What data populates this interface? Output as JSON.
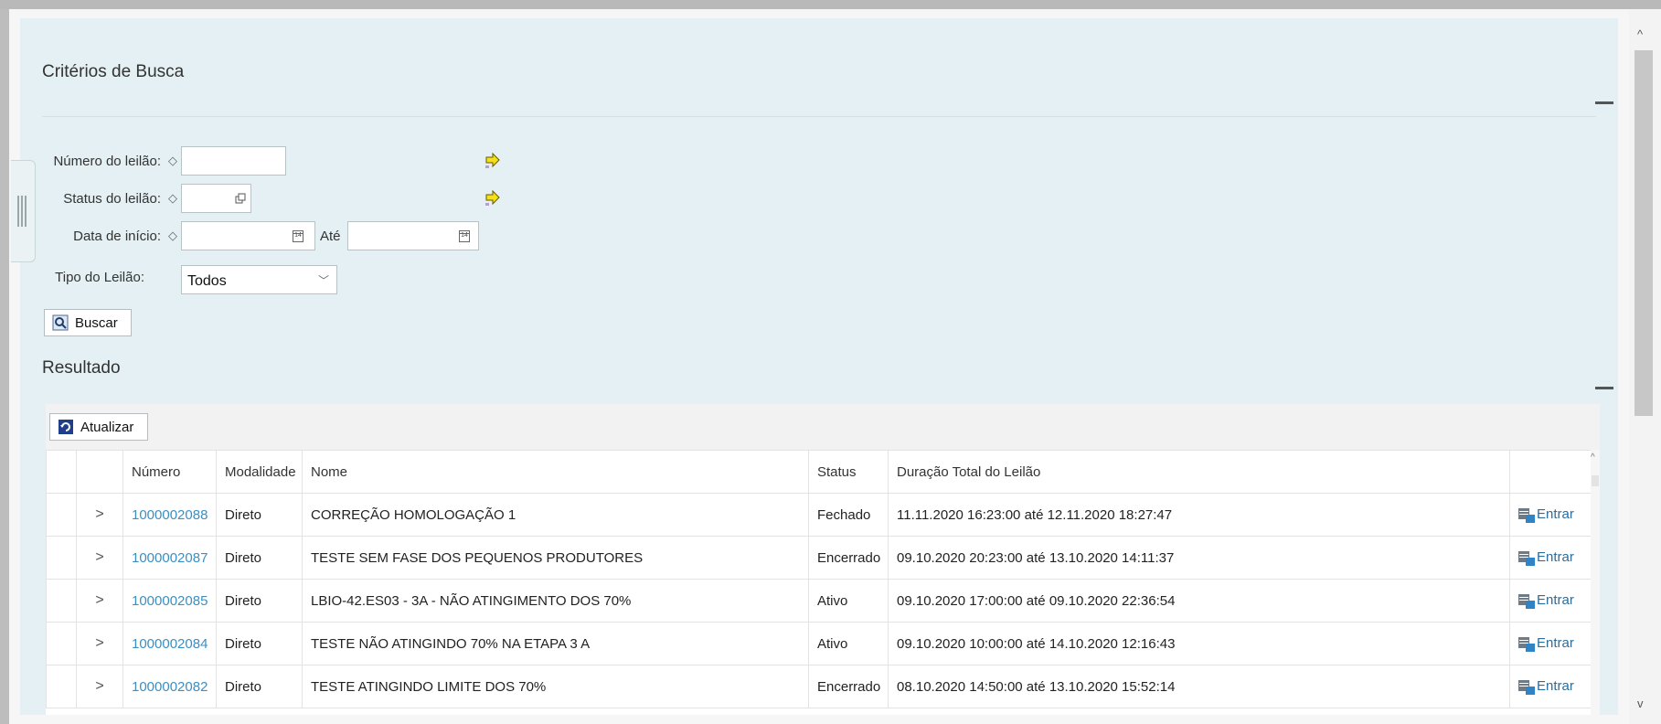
{
  "criteria": {
    "title": "Critérios de Busca",
    "fields": {
      "numero_label": "Número do leilão:",
      "status_label": "Status do leilão:",
      "data_inicio_label": "Data de início:",
      "ate_label": "Até",
      "tipo_label": "Tipo do Leilão:",
      "tipo_value": "Todos"
    },
    "search_button": "Buscar"
  },
  "results": {
    "title": "Resultado",
    "refresh_button": "Atualizar",
    "columns": [
      "Número",
      "Modalidade",
      "Nome",
      "Status",
      "Duração Total do Leilão"
    ],
    "rows": [
      {
        "numero": "1000002088",
        "modalidade": "Direto",
        "nome": "CORREÇÃO HOMOLOGAÇÃO 1",
        "status": "Fechado",
        "duracao": "11.11.2020 16:23:00 até 12.11.2020 18:27:47",
        "acao": "Entrar"
      },
      {
        "numero": "1000002087",
        "modalidade": "Direto",
        "nome": "TESTE SEM FASE DOS PEQUENOS PRODUTORES",
        "status": "Encerrado",
        "duracao": "09.10.2020 20:23:00 até 13.10.2020 14:11:37",
        "acao": "Entrar"
      },
      {
        "numero": "1000002085",
        "modalidade": "Direto",
        "nome": "LBIO-42.ES03 - 3A - NÃO ATINGIMENTO DOS 70%",
        "status": "Ativo",
        "duracao": "09.10.2020 17:00:00 até 09.10.2020 22:36:54",
        "acao": "Entrar"
      },
      {
        "numero": "1000002084",
        "modalidade": "Direto",
        "nome": "TESTE NÃO ATINGINDO 70% NA ETAPA 3 A",
        "status": "Ativo",
        "duracao": "09.10.2020 10:00:00 até 14.10.2020 12:16:43",
        "acao": "Entrar"
      },
      {
        "numero": "1000002082",
        "modalidade": "Direto",
        "nome": "TESTE ATINGINDO LIMITE DOS 70%",
        "status": "Encerrado",
        "duracao": "08.10.2020 14:50:00 até 13.10.2020 15:52:14",
        "acao": "Entrar"
      }
    ]
  },
  "icons": {
    "required": "diamond-icon",
    "go": "yellow-arrow-icon",
    "calendar": "calendar-icon",
    "value_help": "value-help-icon",
    "search": "search-icon",
    "refresh": "refresh-icon",
    "enter": "grid-icon"
  },
  "colors": {
    "panel_bg": "#e4f0f3",
    "link": "#3b8fc1"
  }
}
